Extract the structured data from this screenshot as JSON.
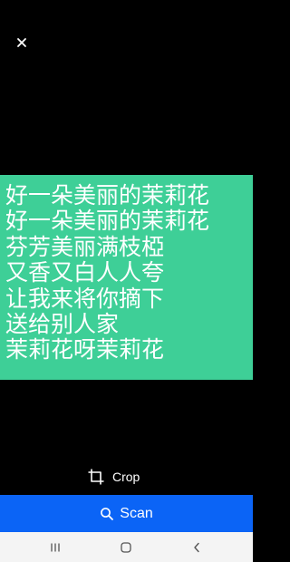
{
  "icons": {
    "close": "close-icon",
    "crop": "crop-icon",
    "search": "search-icon",
    "recents": "recents-icon",
    "home": "home-icon",
    "back": "back-icon"
  },
  "colors": {
    "background": "#000000",
    "image_background": "#3ecf97",
    "scan_button": "#0b64f6",
    "nav_bar": "#f4f4f4",
    "text": "#ffffff"
  },
  "image": {
    "lines": [
      "好一朵美丽的茉莉花",
      "好一朵美丽的茉莉花",
      "芬芳美丽满枝椏",
      "又香又白人人夸",
      "让我来将你摘下",
      "送给别人家",
      "茉莉花呀茉莉花"
    ]
  },
  "toolbar": {
    "crop_label": "Crop"
  },
  "scan": {
    "label": "Scan"
  }
}
